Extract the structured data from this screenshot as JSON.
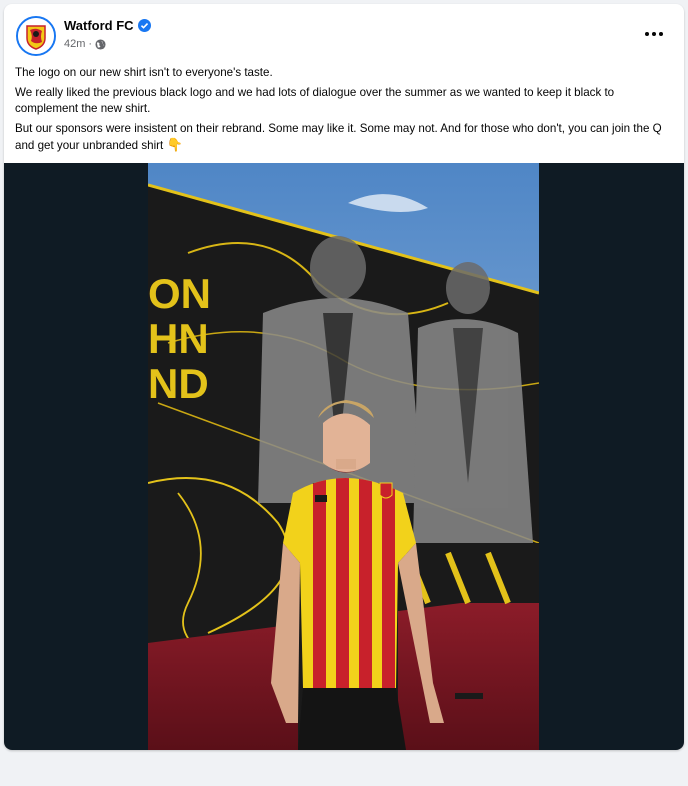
{
  "post": {
    "author": "Watford FC",
    "verified_icon": "verified-badge-icon",
    "timestamp": "42m",
    "separator": "·",
    "privacy_icon": "globe-icon",
    "more_icon": "more-options-icon",
    "paragraphs": [
      "The logo on our new shirt isn't to everyone's taste.",
      "We really liked the previous black logo and we had lots of dialogue over the summer as we wanted to keep it black to complement the new shirt.",
      "But our sponsors were insistent on their rebrand. Some may like it. Some may not. And for those who don't, you can join the Q and get your unbranded shirt"
    ],
    "emoji": "👇",
    "photo_mural_text": [
      "ON",
      "HN",
      "ND"
    ]
  },
  "colors": {
    "accent": "#1877f2",
    "shirt_yellow": "#f2d21b",
    "shirt_red": "#c8212b",
    "media_background": "#0f1b24"
  }
}
